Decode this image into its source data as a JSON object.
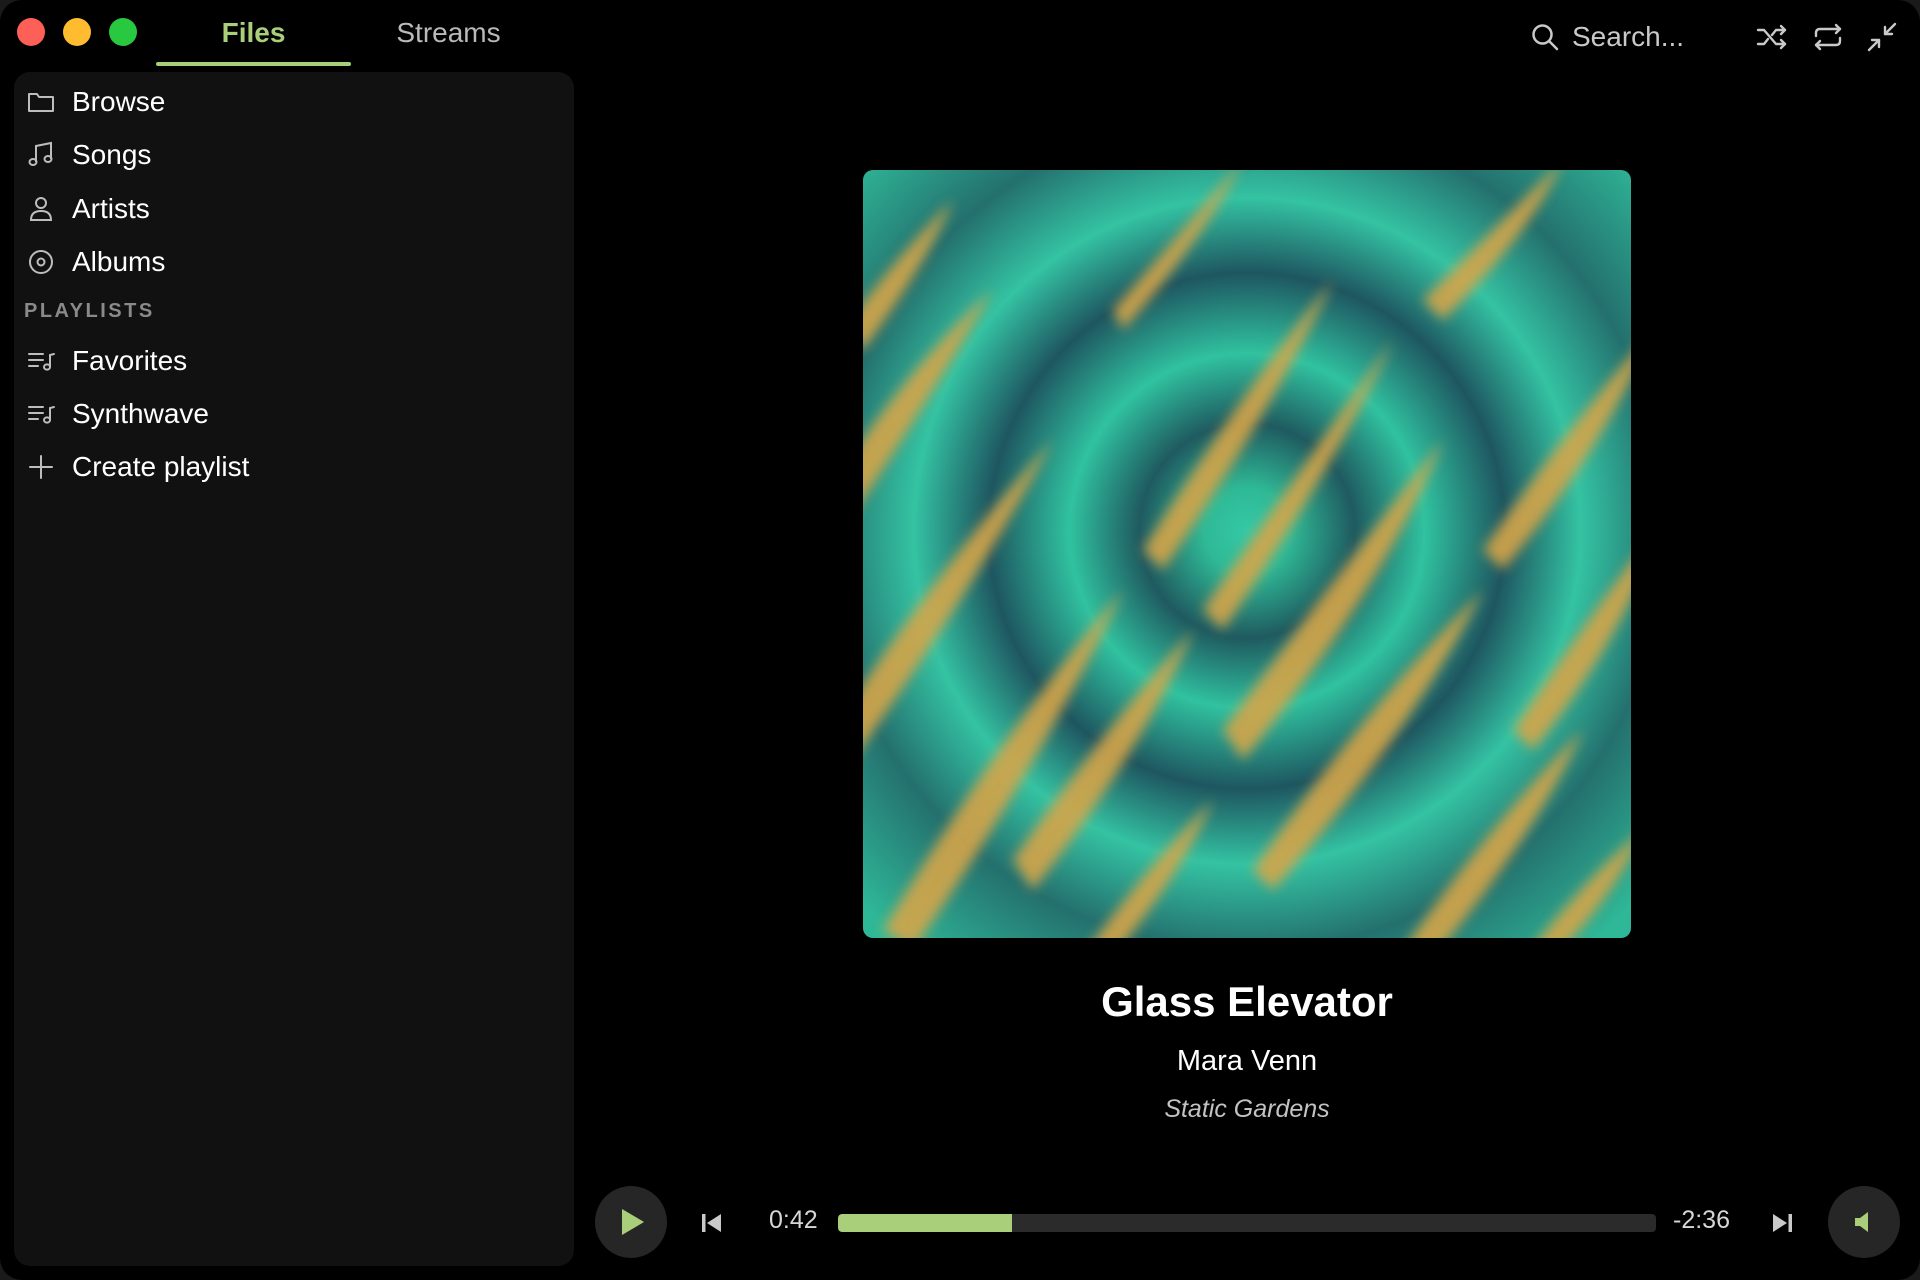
{
  "window": {
    "tabs": [
      {
        "label": "Files",
        "active": true
      },
      {
        "label": "Streams",
        "active": false
      }
    ],
    "search": {
      "placeholder": "Search..."
    },
    "toolbar_icons": [
      "shuffle-icon",
      "repeat-icon",
      "minimize-icon"
    ]
  },
  "sidebar": {
    "items": [
      {
        "label": "Browse",
        "icon": "folder-icon"
      },
      {
        "label": "Songs",
        "icon": "music-note-icon"
      },
      {
        "label": "Artists",
        "icon": "person-icon"
      },
      {
        "label": "Albums",
        "icon": "disc-icon"
      }
    ],
    "section_label": "PLAYLISTS",
    "playlists": [
      {
        "label": "Favorites",
        "icon": "playlist-icon"
      },
      {
        "label": "Synthwave",
        "icon": "playlist-icon"
      }
    ],
    "create_label": "Create playlist"
  },
  "now_playing": {
    "title": "Glass Elevator",
    "artist": "Mara Venn",
    "album": "Static Gardens"
  },
  "player": {
    "elapsed": "0:42",
    "remaining": "-2:36",
    "progress_fraction": 0.2125
  },
  "colors": {
    "accent": "#a9cf7b",
    "background": "#000000",
    "sidebar": "#111111",
    "cover_teal": "#2fbf9f",
    "cover_gold": "#d8a848"
  }
}
